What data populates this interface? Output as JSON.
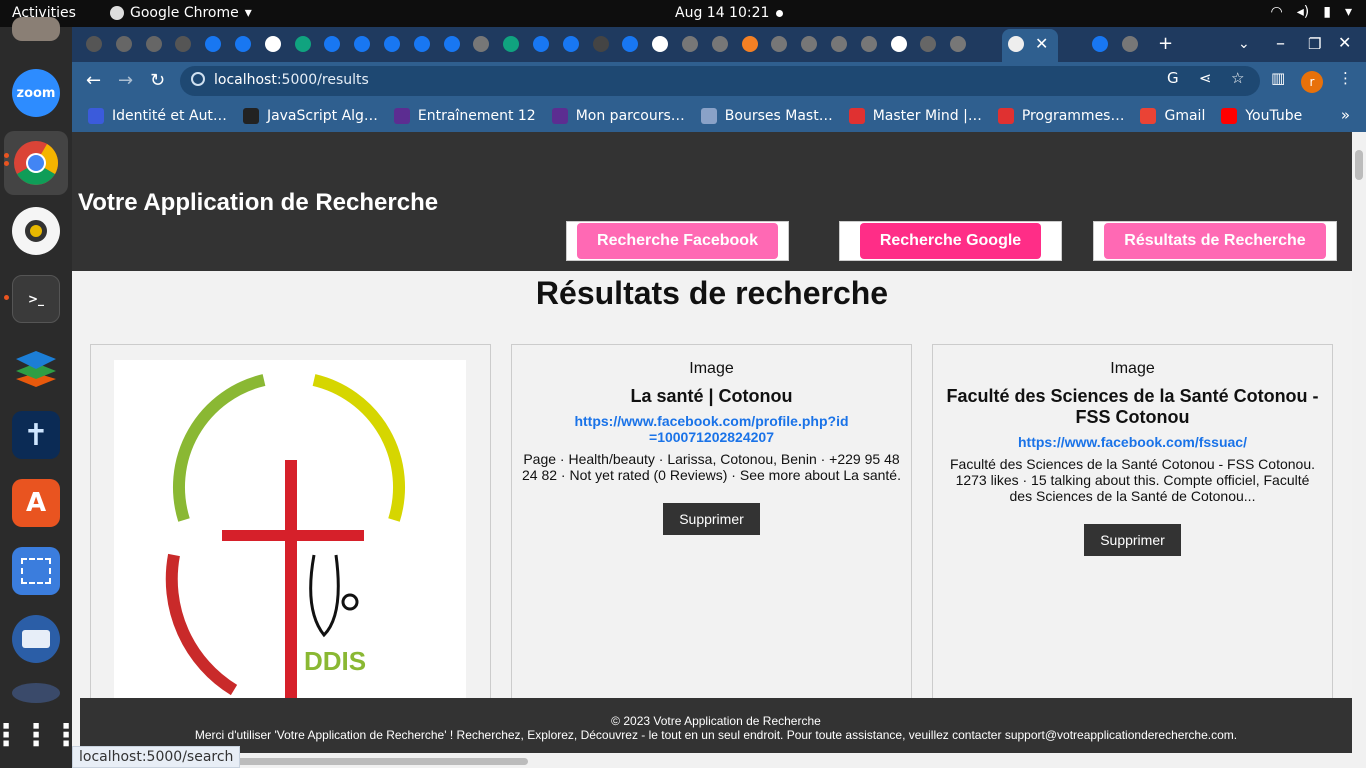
{
  "os": {
    "activities": "Activities",
    "app_name": "Google Chrome",
    "clock": "Aug 14  10:21"
  },
  "browser": {
    "url_host": "localhost",
    "url_path": ":5000/results",
    "avatar_letter": "r",
    "bookmarks": [
      {
        "label": "Identité et Aut…",
        "color": "#3b5bdb"
      },
      {
        "label": "JavaScript Alg…",
        "color": "#222222"
      },
      {
        "label": "Entraînement 12",
        "color": "#5c2d91"
      },
      {
        "label": "Mon parcours…",
        "color": "#5c2d91"
      },
      {
        "label": "Bourses Mast…",
        "color": "#8aa2c8"
      },
      {
        "label": "Master Mind |…",
        "color": "#e03131"
      },
      {
        "label": "Programmes…",
        "color": "#e03131"
      },
      {
        "label": "Gmail",
        "color": "#ea4335"
      },
      {
        "label": "YouTube",
        "color": "#ff0000"
      }
    ],
    "status_url": "localhost:5000/search"
  },
  "site": {
    "title": "Votre Application de Recherche",
    "nav": {
      "facebook": "Recherche Facebook",
      "google": "Recherche Google",
      "results": "Résultats de Recherche"
    },
    "heading": "Résultats de recherche",
    "logo_alt": "DDIS",
    "results": [
      {
        "image_alt": "Image",
        "title": "La santé | Cotonou",
        "link": "https://www.facebook.com/profile.php?id=100071202824207",
        "description": "Page · Health/beauty · Larissa, Cotonou, Benin · +229 95 48 24 82 · Not yet rated (0 Reviews) · See more about La santé.",
        "delete": "Supprimer"
      },
      {
        "image_alt": "Image",
        "title": "Faculté des Sciences de la Santé Cotonou - FSS Cotonou",
        "link": "https://www.facebook.com/fssuac/",
        "description": "Faculté des Sciences de la Santé Cotonou - FSS Cotonou. 1273 likes · 15 talking about this. Compte officiel, Faculté des Sciences de la Santé de Cotonou...",
        "delete": "Supprimer"
      }
    ],
    "footer": {
      "copyright": "© 2023 Votre Application de Recherche",
      "message": "Merci d'utiliser 'Votre Application de Recherche' ! Recherchez, Explorez, Découvrez - le tout en un seul endroit. Pour toute assistance, veuillez contacter support@votreapplicationderecherche.com."
    }
  },
  "colors": {
    "header_bg": "#333333",
    "pink_button": "#ff69b4",
    "pink_button_active": "#ff2d87",
    "link": "#1a73e8",
    "chrome_frame": "#2f5f8f"
  }
}
